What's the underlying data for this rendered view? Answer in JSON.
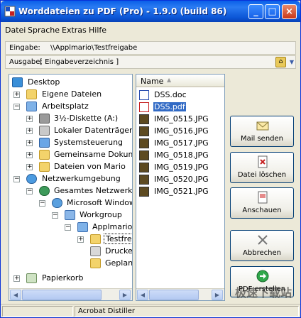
{
  "window": {
    "title": "Worddateien zu PDF (Pro) - 1.9.0 (build 86)"
  },
  "menu": [
    "Datei",
    "Sprache",
    "Extras",
    "Hilfe"
  ],
  "input": {
    "label": "Eingabe:",
    "value": "\\\\Applmario\\Testfreigabe"
  },
  "output": {
    "label": "Ausgabe:",
    "value": "[ Eingabeverzeichnis ]"
  },
  "tree": [
    {
      "label": "Desktop",
      "icon": "desktop-icon"
    },
    {
      "label": "Eigene Dateien",
      "icon": "documents-folder-icon"
    },
    {
      "label": "Arbeitsplatz",
      "icon": "computer-icon"
    },
    {
      "label": "3½-Diskette (A:)",
      "icon": "floppy-drive-icon"
    },
    {
      "label": "Lokaler Datenträger (C",
      "icon": "hard-drive-icon"
    },
    {
      "label": "Systemsteuerung",
      "icon": "control-panel-icon"
    },
    {
      "label": "Gemeinsame Dokumer",
      "icon": "folder-icon"
    },
    {
      "label": "Dateien von Mario",
      "icon": "folder-icon"
    },
    {
      "label": "Netzwerkumgebung",
      "icon": "network-icon"
    },
    {
      "label": "Gesamtes Netzwerk",
      "icon": "globe-icon"
    },
    {
      "label": "Microsoft Windows-",
      "icon": "network-provider-icon"
    },
    {
      "label": "Workgroup",
      "icon": "workgroup-icon"
    },
    {
      "label": "Applmario",
      "icon": "computer-icon"
    },
    {
      "label": "Testfre",
      "icon": "shared-folder-icon"
    },
    {
      "label": "Drucker",
      "icon": "printer-icon"
    },
    {
      "label": "Geplant",
      "icon": "scheduled-tasks-icon"
    },
    {
      "label": "Papierkorb",
      "icon": "recycle-bin-icon"
    }
  ],
  "files": {
    "column": "Name",
    "items": [
      {
        "name": "DSS.doc",
        "icon": "word-doc-icon"
      },
      {
        "name": "DSS.pdf",
        "icon": "pdf-icon"
      },
      {
        "name": "IMG_0515.JPG",
        "icon": "image-icon"
      },
      {
        "name": "IMG_0516.JPG",
        "icon": "image-icon"
      },
      {
        "name": "IMG_0517.JPG",
        "icon": "image-icon"
      },
      {
        "name": "IMG_0518.JPG",
        "icon": "image-icon"
      },
      {
        "name": "IMG_0519.JPG",
        "icon": "image-icon"
      },
      {
        "name": "IMG_0520.JPG",
        "icon": "image-icon"
      },
      {
        "name": "IMG_0521.JPG",
        "icon": "image-icon"
      }
    ]
  },
  "actions": [
    {
      "label": "Mail senden",
      "icon": "mail-icon"
    },
    {
      "label": "Datei löschen",
      "icon": "delete-file-icon"
    },
    {
      "label": "Anschauen",
      "icon": "view-icon"
    },
    {
      "label": "Abbrechen",
      "icon": "cancel-icon"
    },
    {
      "label": "PDF erstellen",
      "icon": "create-pdf-icon"
    }
  ],
  "status": {
    "printer": "Acrobat Distiller"
  },
  "watermark": "极速下载站",
  "colors": {
    "titlebar": "#0a5fe8",
    "selection": "#316ac5",
    "window_bg": "#ece9d8"
  }
}
